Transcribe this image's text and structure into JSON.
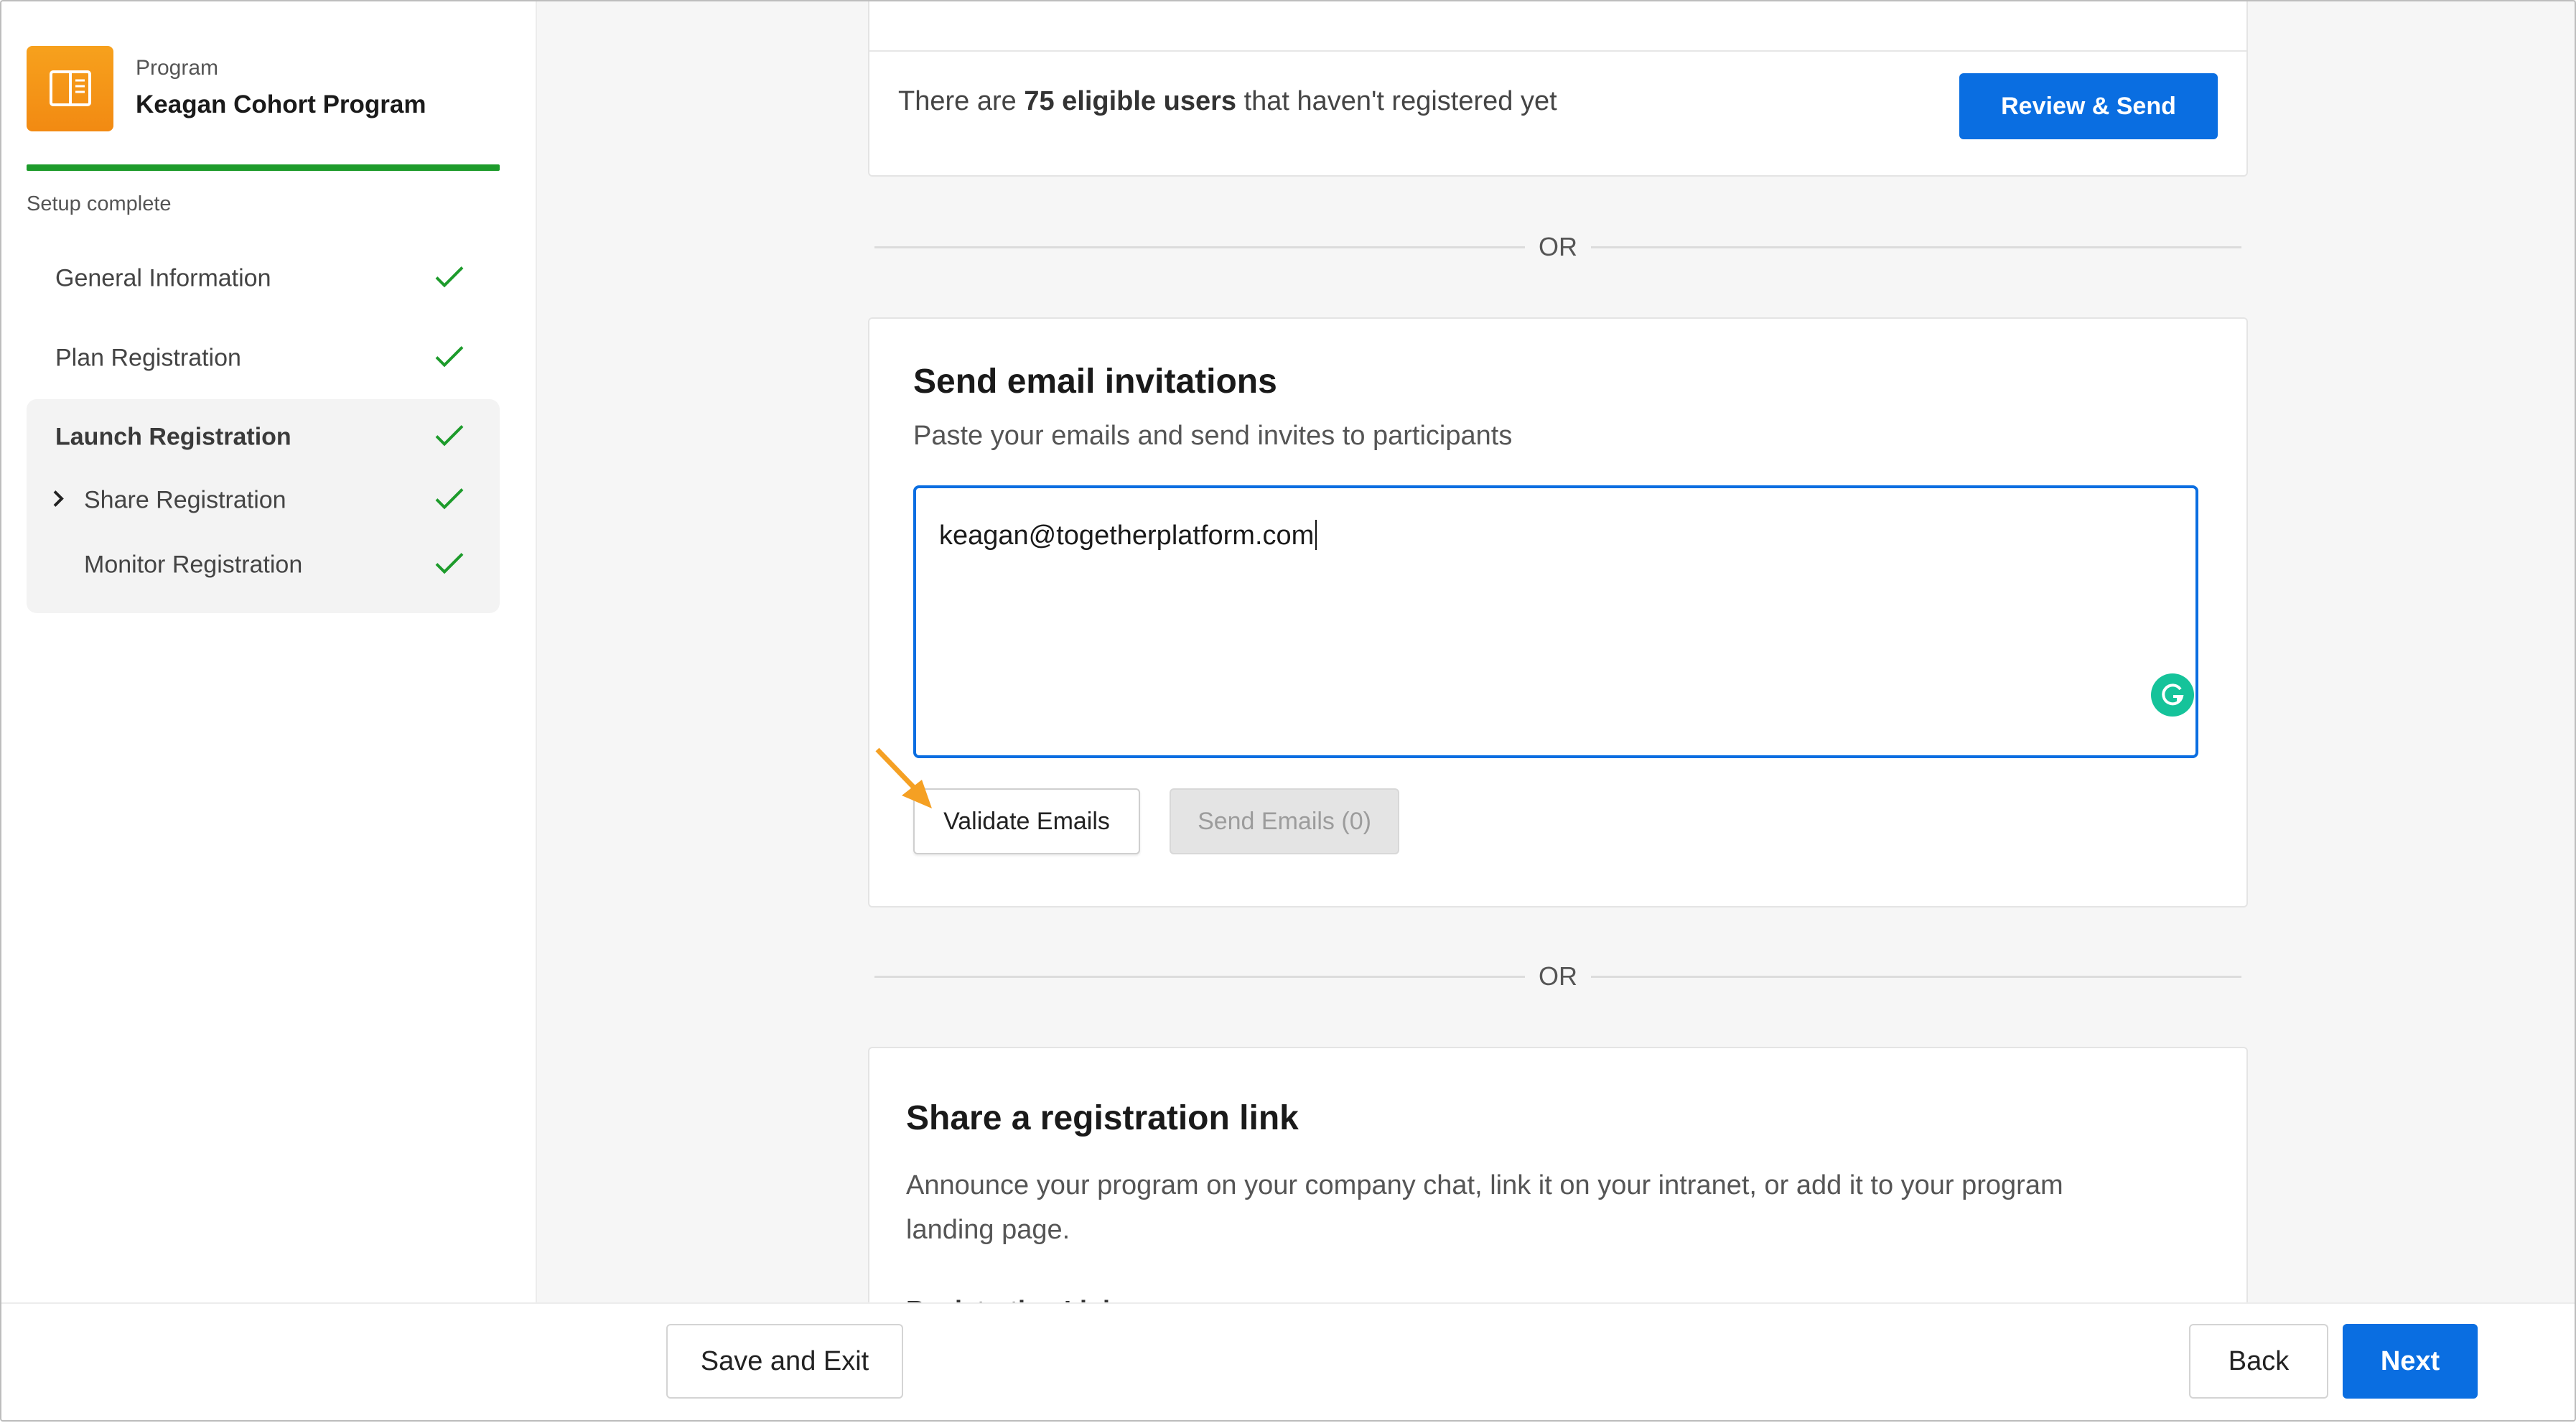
{
  "sidebar": {
    "program_label": "Program",
    "program_name": "Keagan Cohort Program",
    "setup_status": "Setup complete",
    "items": [
      {
        "label": "General Information"
      },
      {
        "label": "Plan Registration"
      },
      {
        "label": "Launch Registration"
      },
      {
        "label": "Share Registration"
      },
      {
        "label": "Monitor Registration"
      }
    ]
  },
  "eligible": {
    "prefix": "There are ",
    "count": "75 eligible users",
    "suffix": " that haven't registered yet",
    "button": "Review & Send"
  },
  "separator": "OR",
  "email_invites": {
    "title": "Send email invitations",
    "subtitle": "Paste your emails and send invites to participants",
    "textarea_value": "keagan@togetherplatform.com",
    "validate_button": "Validate Emails",
    "send_button": "Send Emails (0)"
  },
  "share_link": {
    "title": "Share a registration link",
    "description_line1": "Announce your program on your company chat, link it on your intranet, or add it to your program",
    "description_line2": "landing page.",
    "link_label": "Registration Link"
  },
  "footer": {
    "save_exit": "Save and Exit",
    "back": "Back",
    "next": "Next"
  },
  "colors": {
    "primary": "#0a6ee1",
    "success": "#1d9b2b",
    "program_icon": "#f7a11d",
    "grammarly": "#15c39a"
  }
}
